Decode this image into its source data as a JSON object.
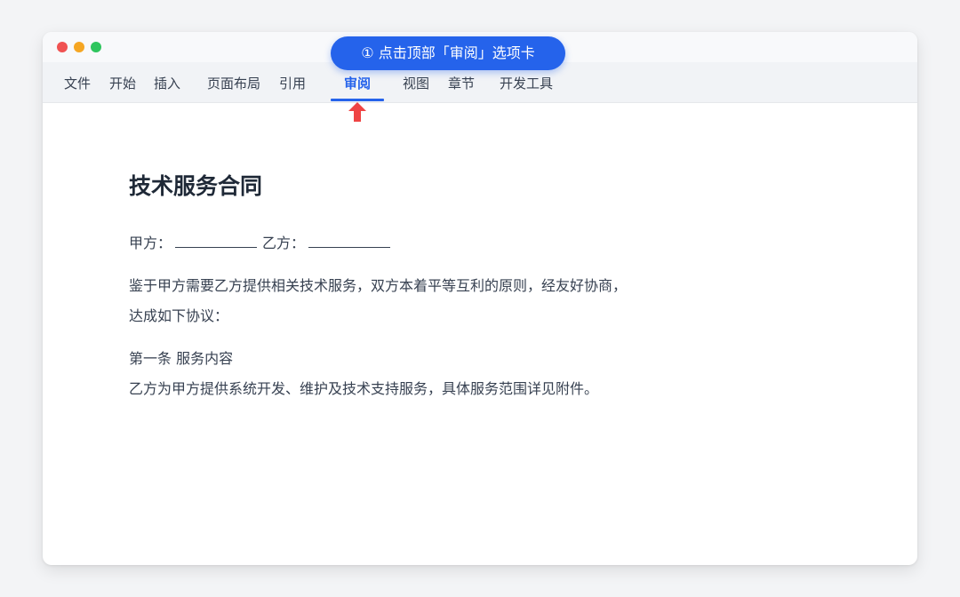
{
  "window": {
    "controls": [
      "close",
      "minimize",
      "maximize"
    ]
  },
  "menu": {
    "items": [
      "文件",
      "开始",
      "插入",
      "页面布局",
      "引用",
      "审阅",
      "视图",
      "章节",
      "开发工具"
    ],
    "active": "审阅"
  },
  "tooltip": {
    "text": "① 点击顶部「审阅」选项卡"
  },
  "document": {
    "title": "技术服务合同",
    "party_a_label": "甲方：",
    "party_b_label": "乙方：",
    "paragraph1_line1": "鉴于甲方需要乙方提供相关技术服务，双方本着平等互利的原则，经友好协商，",
    "paragraph1_line2": "达成如下协议：",
    "article1_heading": "第一条 服务内容",
    "article1_text": "乙方为甲方提供系统开发、维护及技术支持服务，具体服务范围详见附件。"
  },
  "colors": {
    "accent": "#2563eb",
    "arrow": "#ef4444",
    "close": "#f05252",
    "minimize": "#f5a623",
    "maximize": "#2fc55e"
  }
}
